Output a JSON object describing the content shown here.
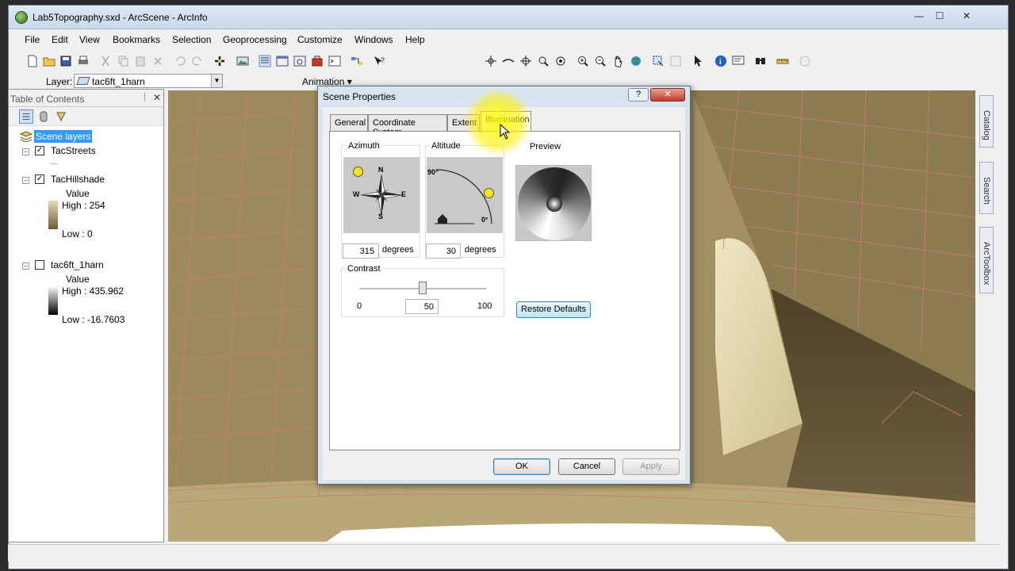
{
  "window": {
    "title": "Lab5Topography.sxd - ArcScene - ArcInfo",
    "min": "—",
    "max": "☐",
    "close": "✕"
  },
  "menu": [
    "File",
    "Edit",
    "View",
    "Bookmarks",
    "Selection",
    "Geoprocessing",
    "Customize",
    "Windows",
    "Help"
  ],
  "layer_toolbar": {
    "label": "Layer:",
    "value": "tac6ft_1harn",
    "animation": "Animation ▾"
  },
  "toc": {
    "title": "Table of Contents",
    "pin": "ᛁ",
    "close": "✕",
    "root": "Scene layers",
    "layers": [
      {
        "name": "TacStreets",
        "checked": "✓",
        "expander": "−"
      },
      {
        "name": "TacHillshade",
        "checked": "✓",
        "expander": "−",
        "value_label": "Value",
        "high": "High : 254",
        "low": "Low : 0"
      },
      {
        "name": "tac6ft_1harn",
        "checked": "",
        "expander": "−",
        "value_label": "Value",
        "high": "High : 435.962",
        "low": "Low : -16.7603"
      }
    ]
  },
  "right_dock": [
    "Catalog",
    "Search",
    "ArcToolbox"
  ],
  "dialog": {
    "title": "Scene Properties",
    "help": "?",
    "close": "✕",
    "tabs": [
      "General",
      "Coordinate System",
      "Extent",
      "Illumination"
    ],
    "active_tab": "Illumination",
    "azimuth": {
      "label": "Azimuth",
      "value": "315",
      "unit": "degrees",
      "north": "N",
      "south": "S",
      "east": "E",
      "west": "W"
    },
    "altitude": {
      "label": "Altitude",
      "value": "30",
      "unit": "degrees",
      "top": "90°",
      "bottom": "0°"
    },
    "preview": {
      "label": "Preview"
    },
    "contrast": {
      "label": "Contrast",
      "min": "0",
      "value": "50",
      "max": "100",
      "level": 0.5
    },
    "restore_defaults": "Restore Defaults",
    "ok": "OK",
    "cancel": "Cancel",
    "apply": "Apply"
  },
  "colors": {
    "accent": "#3c7fb1",
    "highlight": "#fff200",
    "street_lines": "#d07a72"
  }
}
